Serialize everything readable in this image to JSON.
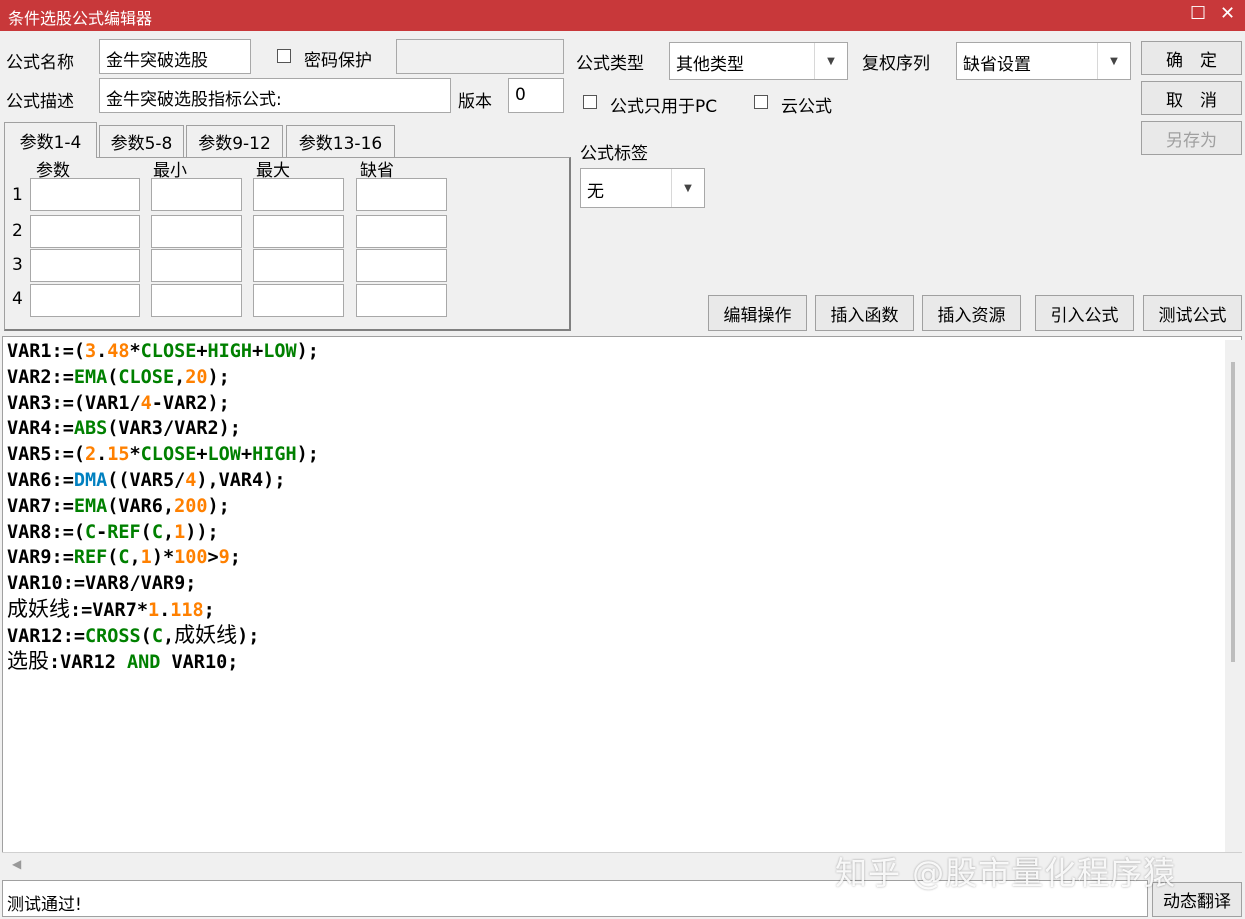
{
  "window": {
    "title": "条件选股公式编辑器",
    "maximize_glyph": "☐",
    "close_glyph": "✕"
  },
  "form": {
    "name_label": "公式名称",
    "name_value": "金牛突破选股",
    "password_label": "密码保护",
    "password_checked": false,
    "desc_label": "公式描述",
    "desc_value": "金牛突破选股指标公式:",
    "version_label": "版本",
    "version_value": "0",
    "type_label": "公式类型",
    "type_value": "其他类型",
    "rights_label": "复权序列",
    "rights_value": "缺省设置",
    "pc_only_label": "公式只用于PC",
    "cloud_label": "云公式",
    "tag_label": "公式标签",
    "tag_value": "无"
  },
  "buttons": {
    "ok": "确　定",
    "cancel": "取　消",
    "save_as": "另存为",
    "edit_ops": "编辑操作",
    "insert_func": "插入函数",
    "insert_res": "插入资源",
    "import_formula": "引入公式",
    "test_formula": "测试公式",
    "dynamic_translate": "动态翻译"
  },
  "params": {
    "tabs": [
      "参数1-4",
      "参数5-8",
      "参数9-12",
      "参数13-16"
    ],
    "active_tab": 0,
    "headers": [
      "参数",
      "最小",
      "最大",
      "缺省"
    ],
    "rows": [
      "1",
      "2",
      "3",
      "4"
    ]
  },
  "colors": {
    "title_bar": "#c8383a",
    "number": "#ff8000",
    "function": "#008000",
    "dma": "#0080c0",
    "text": "#000000"
  },
  "code": [
    [
      {
        "t": "VAR1:=("
      },
      {
        "t": "3",
        "c": "n"
      },
      {
        "t": "."
      },
      {
        "t": "48",
        "c": "n"
      },
      {
        "t": "*"
      },
      {
        "t": "CLOSE",
        "c": "f"
      },
      {
        "t": "+"
      },
      {
        "t": "HIGH",
        "c": "f"
      },
      {
        "t": "+"
      },
      {
        "t": "LOW",
        "c": "f"
      },
      {
        "t": ");"
      }
    ],
    [
      {
        "t": "VAR2:="
      },
      {
        "t": "EMA",
        "c": "f"
      },
      {
        "t": "("
      },
      {
        "t": "CLOSE",
        "c": "f"
      },
      {
        "t": ","
      },
      {
        "t": "20",
        "c": "n"
      },
      {
        "t": ");"
      }
    ],
    [
      {
        "t": "VAR3:=(VAR1/"
      },
      {
        "t": "4",
        "c": "n"
      },
      {
        "t": "-VAR2);"
      }
    ],
    [
      {
        "t": "VAR4:="
      },
      {
        "t": "ABS",
        "c": "f"
      },
      {
        "t": "(VAR3/VAR2);"
      }
    ],
    [
      {
        "t": "VAR5:=("
      },
      {
        "t": "2",
        "c": "n"
      },
      {
        "t": "."
      },
      {
        "t": "15",
        "c": "n"
      },
      {
        "t": "*"
      },
      {
        "t": "CLOSE",
        "c": "f"
      },
      {
        "t": "+"
      },
      {
        "t": "LOW",
        "c": "f"
      },
      {
        "t": "+"
      },
      {
        "t": "HIGH",
        "c": "f"
      },
      {
        "t": ");"
      }
    ],
    [
      {
        "t": "VAR6:="
      },
      {
        "t": "DMA",
        "c": "d"
      },
      {
        "t": "((VAR5/"
      },
      {
        "t": "4",
        "c": "n"
      },
      {
        "t": "),VAR4);"
      }
    ],
    [
      {
        "t": "VAR7:="
      },
      {
        "t": "EMA",
        "c": "f"
      },
      {
        "t": "(VAR6,"
      },
      {
        "t": "200",
        "c": "n"
      },
      {
        "t": ");"
      }
    ],
    [
      {
        "t": "VAR8:=("
      },
      {
        "t": "C",
        "c": "f"
      },
      {
        "t": "-"
      },
      {
        "t": "REF",
        "c": "f"
      },
      {
        "t": "("
      },
      {
        "t": "C",
        "c": "f"
      },
      {
        "t": ","
      },
      {
        "t": "1",
        "c": "n"
      },
      {
        "t": "));"
      }
    ],
    [
      {
        "t": "VAR9:="
      },
      {
        "t": "REF",
        "c": "f"
      },
      {
        "t": "("
      },
      {
        "t": "C",
        "c": "f"
      },
      {
        "t": ","
      },
      {
        "t": "1",
        "c": "n"
      },
      {
        "t": ")*"
      },
      {
        "t": "100",
        "c": "n"
      },
      {
        "t": ">"
      },
      {
        "t": "9",
        "c": "n"
      },
      {
        "t": ";"
      }
    ],
    [
      {
        "t": "VAR10:=VAR8/VAR9;"
      }
    ],
    [
      {
        "t": "成妖线",
        "c": "z"
      },
      {
        "t": ":=VAR7*"
      },
      {
        "t": "1",
        "c": "n"
      },
      {
        "t": "."
      },
      {
        "t": "118",
        "c": "n"
      },
      {
        "t": ";"
      }
    ],
    [
      {
        "t": "VAR12:="
      },
      {
        "t": "CROSS",
        "c": "f"
      },
      {
        "t": "("
      },
      {
        "t": "C",
        "c": "f"
      },
      {
        "t": ","
      },
      {
        "t": "成妖线",
        "c": "z"
      },
      {
        "t": ");"
      }
    ],
    [
      {
        "t": "选股",
        "c": "z"
      },
      {
        "t": ":VAR12 "
      },
      {
        "t": "AND",
        "c": "f"
      },
      {
        "t": " VAR10;"
      }
    ]
  ],
  "status": {
    "message": "测试通过!"
  },
  "watermark": "知乎 @股市量化程序猿"
}
